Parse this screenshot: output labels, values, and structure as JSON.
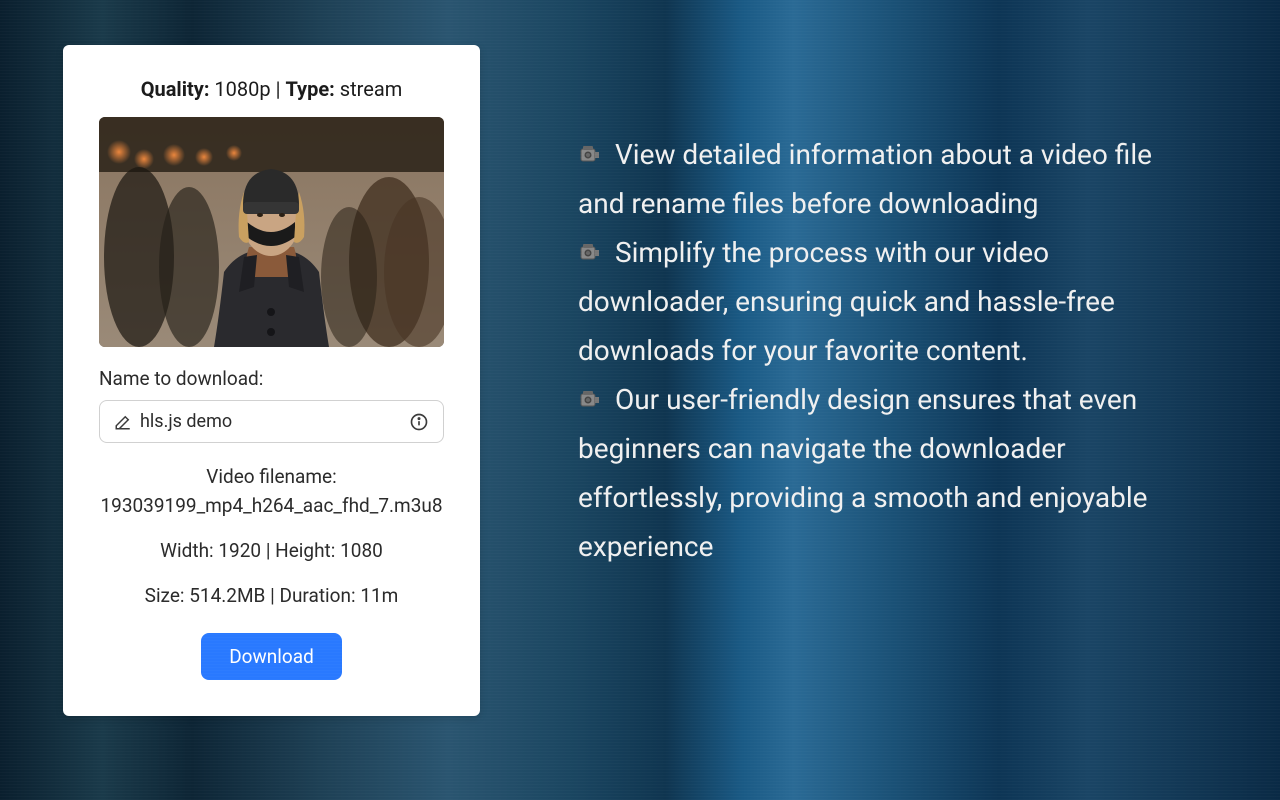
{
  "card": {
    "quality_label": "Quality:",
    "quality_value": "1080p",
    "separator": " | ",
    "type_label": "Type:",
    "type_value": "stream",
    "name_label": "Name to download:",
    "name_value": "hls.js demo",
    "filename_label": "Video filename:",
    "filename_value": "193039199_mp4_h264_aac_fhd_7.m3u8",
    "width_label": "Width:",
    "width_value": "1920",
    "height_label": "Height:",
    "height_value": "1080",
    "size_label": "Size:",
    "size_value": "514.2MB",
    "duration_label": "Duration:",
    "duration_value": "11m",
    "download_button": "Download"
  },
  "features": {
    "item1": "View detailed information about a video file and rename files  before downloading",
    "item2": "Simplify the process with our video downloader, ensuring quick and hassle-free downloads for your favorite content.",
    "item3": "Our user-friendly design ensures that even beginners can navigate the downloader effortlessly, providing a smooth and enjoyable experience"
  }
}
